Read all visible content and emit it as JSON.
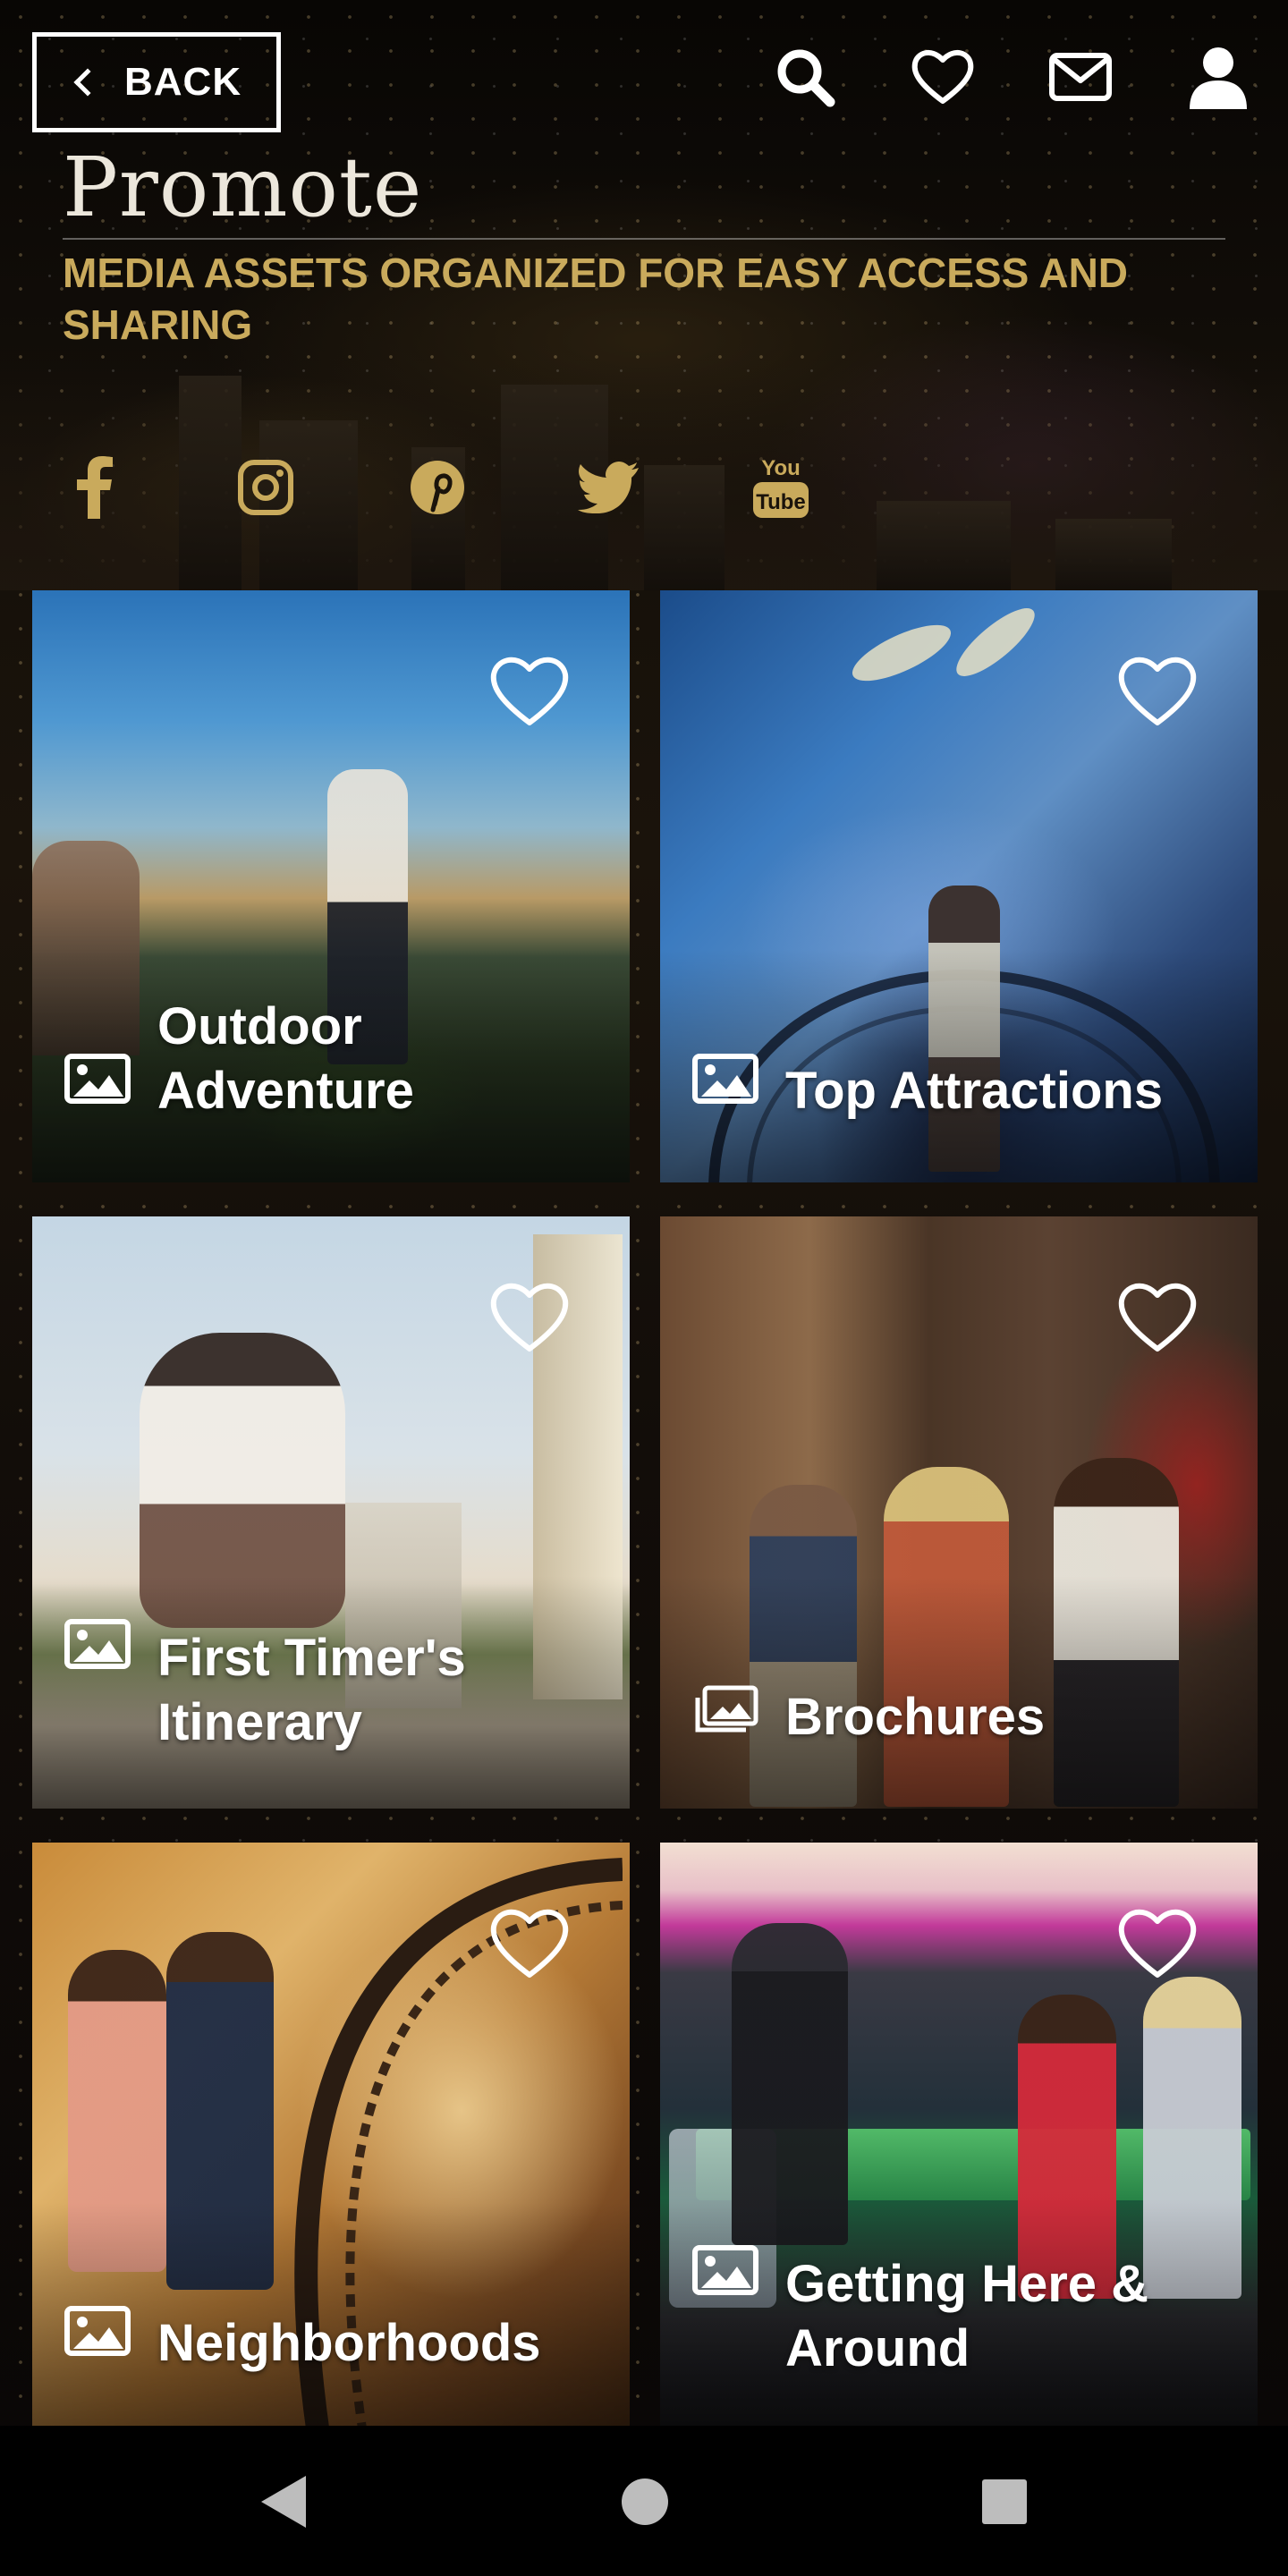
{
  "header": {
    "back_label": "BACK",
    "title": "Promote",
    "subtitle": "MEDIA ASSETS ORGANIZED FOR EASY ACCESS AND SHARING"
  },
  "top_icons": [
    "search-icon",
    "heart-icon",
    "mail-icon",
    "user-icon"
  ],
  "social": {
    "items": [
      "facebook",
      "instagram",
      "pinterest",
      "twitter",
      "youtube"
    ],
    "youtube_line1": "You",
    "youtube_line2": "Tube"
  },
  "tiles": [
    {
      "label": "Outdoor Adventure",
      "icon": "image-icon"
    },
    {
      "label": "Top Attractions",
      "icon": "image-icon"
    },
    {
      "label": "First Timer's Itinerary",
      "icon": "image-icon"
    },
    {
      "label": "Brochures",
      "icon": "images-stack-icon"
    },
    {
      "label": "Neighborhoods",
      "icon": "image-icon"
    },
    {
      "label": "Getting Here & Around",
      "icon": "image-icon"
    }
  ],
  "colors": {
    "accent_gold": "#c9aa5c",
    "title_text": "#ece7dc",
    "social_icon": "#c9aa5c"
  }
}
